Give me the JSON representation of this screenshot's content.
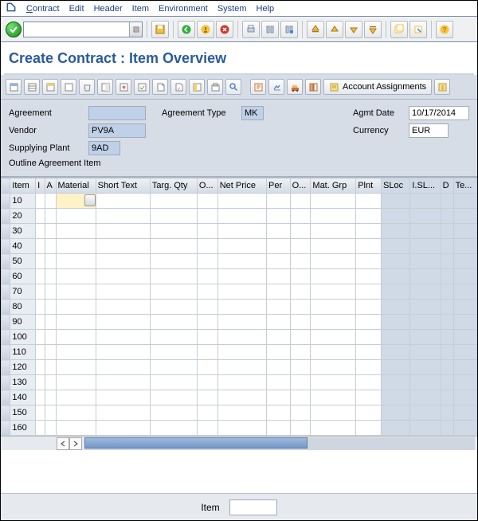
{
  "menu": {
    "contract": "Contract",
    "edit": "Edit",
    "header": "Header",
    "item": "Item",
    "environment": "Environment",
    "system": "System",
    "help": "Help"
  },
  "title": "Create Contract : Item Overview",
  "apptoolbar": {
    "account_assignments": "Account Assignments"
  },
  "header": {
    "agreement_label": "Agreement",
    "agreement_value": "",
    "agreement_type_label": "Agreement Type",
    "agreement_type_value": "MK",
    "agmt_date_label": "Agmt Date",
    "agmt_date_value": "10/17/2014",
    "vendor_label": "Vendor",
    "vendor_value": "PV9A",
    "currency_label": "Currency",
    "currency_value": "EUR",
    "supplying_plant_label": "Supplying Plant",
    "supplying_plant_value": "9AD",
    "section_label": "Outline Agreement Item"
  },
  "grid": {
    "cols": [
      "Item",
      "I",
      "A",
      "Material",
      "Short Text",
      "Targ. Qty",
      "O...",
      "Net Price",
      "Per",
      "O...",
      "Mat. Grp",
      "Plnt",
      "SLoc",
      "I.SL...",
      "D",
      "Te..."
    ],
    "rows": [
      "10",
      "20",
      "30",
      "40",
      "50",
      "60",
      "70",
      "80",
      "90",
      "100",
      "110",
      "120",
      "130",
      "140",
      "150",
      "160"
    ]
  },
  "footer": {
    "item_label": "Item",
    "item_value": ""
  }
}
